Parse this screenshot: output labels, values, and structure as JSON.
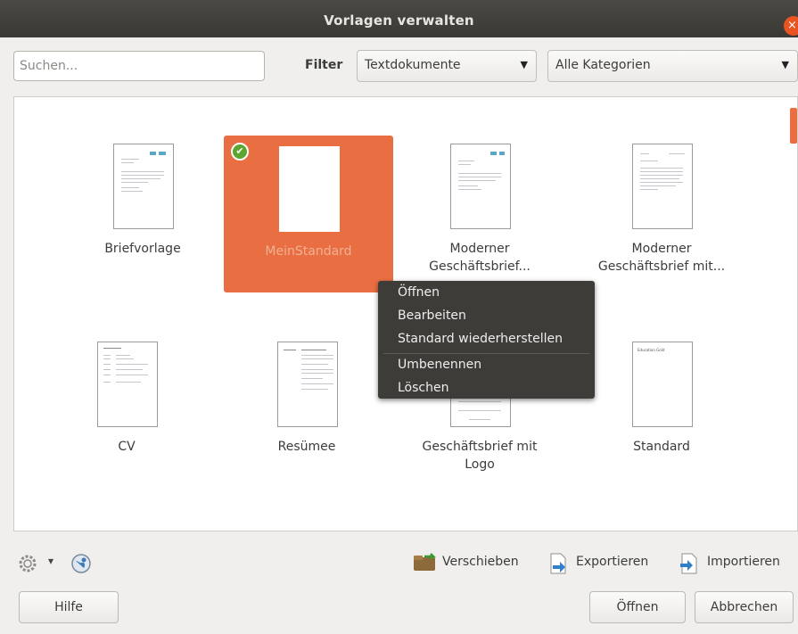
{
  "window": {
    "title": "Vorlagen verwalten",
    "close_icon": "×"
  },
  "search": {
    "placeholder": "Suchen..."
  },
  "filter": {
    "label": "Filter",
    "type_selected": "Textdokumente",
    "category_selected": "Alle Kategorien",
    "arrow": "▼"
  },
  "templates": [
    {
      "name": "Briefvorlage",
      "name2": ""
    },
    {
      "name": "MeinStandard",
      "name2": "",
      "selected": true,
      "default_mark": "✔"
    },
    {
      "name": "Moderner",
      "name2": "Geschäftsbrief..."
    },
    {
      "name": "Moderner",
      "name2": "Geschäftsbrief mit..."
    },
    {
      "name": "CV",
      "name2": ""
    },
    {
      "name": "Resümee",
      "name2": ""
    },
    {
      "name": "Geschäftsbrief mit",
      "name2": "Logo"
    },
    {
      "name": "Standard",
      "name2": "",
      "thumb_text": "Education Gold"
    }
  ],
  "context_menu": {
    "open": "Öffnen",
    "edit": "Bearbeiten",
    "reset_default": "Standard wiederherstellen",
    "rename": "Umbenennen",
    "delete": "Löschen"
  },
  "toolbar": {
    "move": "Verschieben",
    "export": "Exportieren",
    "import": "Importieren",
    "settings_arrow": "▾"
  },
  "footer": {
    "help": "Hilfe",
    "open": "Öffnen",
    "cancel": "Abbrechen"
  },
  "colors": {
    "accent": "#e95420",
    "selection": "#e96f42",
    "titlebar": "#3c3b37",
    "menu_bg": "#3d3c38"
  }
}
